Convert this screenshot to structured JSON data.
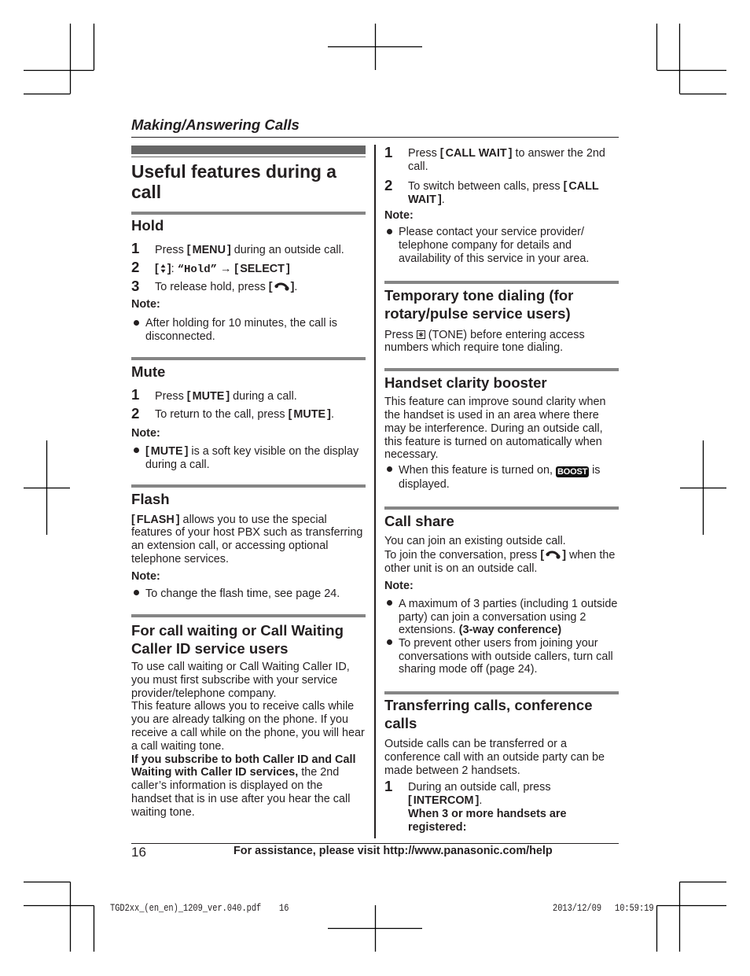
{
  "running_head": "Making/Answering Calls",
  "title": "Useful features during a call",
  "hold": {
    "heading": "Hold",
    "steps": [
      {
        "num": "1",
        "pre": "Press ",
        "key": "MENU",
        "post": " during an outside call."
      },
      {
        "num": "2",
        "key_icon": "navigator-up-down-icon",
        "sep": ": ",
        "menu_item": "“Hold”",
        "arrow": " → ",
        "key": "SELECT"
      },
      {
        "num": "3",
        "pre": "To release hold, press ",
        "key_icon": "phone-talk-icon",
        "post": "."
      }
    ],
    "note_label": "Note:",
    "notes": [
      "After holding for 10 minutes, the call is disconnected."
    ]
  },
  "mute": {
    "heading": "Mute",
    "steps": [
      {
        "num": "1",
        "pre": "Press ",
        "key": "MUTE",
        "post": " during a call."
      },
      {
        "num": "2",
        "pre": "To return to the call, press ",
        "key": "MUTE",
        "post": "."
      }
    ],
    "note_label": "Note:",
    "notes": [
      {
        "key": "MUTE",
        "post": " is a soft key visible on the display during a call."
      }
    ]
  },
  "flash": {
    "heading": "Flash",
    "body": {
      "key": "FLASH",
      "post": " allows you to use the special features of your host PBX such as transferring an extension call, or accessing optional telephone services."
    },
    "note_label": "Note:",
    "notes": [
      "To change the flash time, see page 24."
    ]
  },
  "call_waiting": {
    "heading": "For call waiting or Call Waiting Caller ID service users",
    "paragraphs": [
      "To use call waiting or Call Waiting Caller ID, you must first subscribe with your service provider/telephone company.",
      "This feature allows you to receive calls while you are already talking on the phone. If you receive a call while on the phone, you will hear a call waiting tone."
    ],
    "subscriber_note": {
      "bold": "If you subscribe to both Caller ID and Call Waiting with Caller ID services,",
      "text": " the 2nd caller’s information is displayed on the handset that is in use after you hear the call waiting tone."
    },
    "steps": [
      {
        "num": "1",
        "pre": "Press ",
        "key": "CALL WAIT",
        "post": " to answer the 2nd call."
      },
      {
        "num": "2",
        "pre": "To switch between calls, press ",
        "key": "CALL WAIT",
        "post": "."
      }
    ],
    "note_label": "Note:",
    "notes": [
      "Please contact your service provider/​telephone company for details and availability of this service in your area."
    ]
  },
  "tone_dialing": {
    "heading": "Temporary tone dialing (for rotary/pulse service users)",
    "body": {
      "pre": "Press ",
      "key_icon": "star-key-icon",
      "post": " (TONE) before entering access numbers which require tone dialing."
    }
  },
  "clarity_booster": {
    "heading": "Handset clarity booster",
    "body": "This feature can improve sound clarity when the handset is used in an area where there may be interference. During an outside call, this feature is turned on automatically when necessary.",
    "notes": [
      {
        "pre": "When this feature is turned on, ",
        "display_icon": "BOOST",
        "post": " is displayed."
      }
    ]
  },
  "call_share": {
    "heading": "Call share",
    "intro": "You can join an existing outside call.",
    "join": {
      "pre": "To join the conversation, press ",
      "key_icon": "phone-talk-icon",
      "post": " when the other unit is on an outside call."
    },
    "note_label": "Note:",
    "notes": [
      {
        "text": "A maximum of 3 parties (including 1 outside party) can join a conversation using 2 extensions. ",
        "bold": "(3-way conference)"
      },
      {
        "text": "To prevent other users from joining your conversations with outside callers, turn call sharing mode off (page 24)."
      }
    ]
  },
  "transferring": {
    "heading": "Transferring calls, conference calls",
    "body": "Outside calls can be transferred or a conference call with an outside party can be made between 2 handsets.",
    "steps": [
      {
        "num": "1",
        "pre": "During an outside call, press",
        "key": "INTERCOM",
        "post": ".",
        "sub_heading": "When 3 or more handsets are registered:"
      }
    ]
  },
  "footer": {
    "page_number": "16",
    "assistance_pre": "For assistance, please visit ",
    "url": "http://www.panasonic.com/help"
  },
  "print_slug": {
    "file": "TGD2xx_(en_en)_1209_ver.040.pdf",
    "page": "16",
    "date": "2013/12/09",
    "time": "10:59:19"
  }
}
